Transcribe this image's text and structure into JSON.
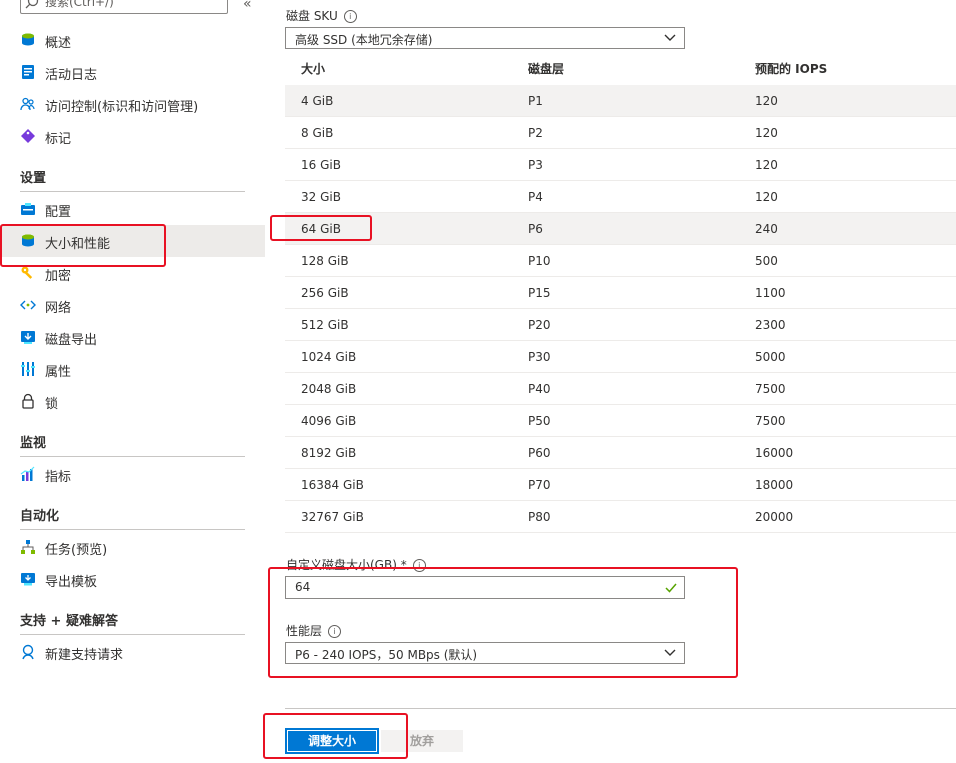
{
  "sidebar": {
    "search_placeholder": "搜索(Ctrl+/)",
    "collapse_glyph": "«",
    "items_top": [
      {
        "label": "概述",
        "icon": "disk-overview-icon"
      },
      {
        "label": "活动日志",
        "icon": "activity-log-icon"
      },
      {
        "label": "访问控制(标识和访问管理)",
        "icon": "access-control-icon"
      },
      {
        "label": "标记",
        "icon": "tag-icon"
      }
    ],
    "sections": [
      {
        "title": "设置",
        "items": [
          {
            "label": "配置",
            "icon": "configuration-icon"
          },
          {
            "label": "大小和性能",
            "icon": "disk-size-icon",
            "active": true
          },
          {
            "label": "加密",
            "icon": "key-icon"
          },
          {
            "label": "网络",
            "icon": "network-icon"
          },
          {
            "label": "磁盘导出",
            "icon": "disk-export-icon"
          },
          {
            "label": "属性",
            "icon": "properties-icon"
          },
          {
            "label": "锁",
            "icon": "lock-icon"
          }
        ]
      },
      {
        "title": "监视",
        "items": [
          {
            "label": "指标",
            "icon": "metrics-icon"
          }
        ]
      },
      {
        "title": "自动化",
        "items": [
          {
            "label": "任务(预览)",
            "icon": "tasks-icon"
          },
          {
            "label": "导出模板",
            "icon": "export-template-icon"
          }
        ]
      },
      {
        "title": "支持 + 疑难解答",
        "items": [
          {
            "label": "新建支持请求",
            "icon": "support-request-icon"
          }
        ]
      }
    ]
  },
  "main": {
    "sku_label": "磁盘 SKU",
    "sku_value": "高级 SSD (本地冗余存储)",
    "table": {
      "headers": [
        "大小",
        "磁盘层",
        "预配的 IOPS"
      ],
      "selected_index": 4,
      "rows": [
        [
          "4 GiB",
          "P1",
          "120"
        ],
        [
          "8 GiB",
          "P2",
          "120"
        ],
        [
          "16 GiB",
          "P3",
          "120"
        ],
        [
          "32 GiB",
          "P4",
          "120"
        ],
        [
          "64 GiB",
          "P6",
          "240"
        ],
        [
          "128 GiB",
          "P10",
          "500"
        ],
        [
          "256 GiB",
          "P15",
          "1100"
        ],
        [
          "512 GiB",
          "P20",
          "2300"
        ],
        [
          "1024 GiB",
          "P30",
          "5000"
        ],
        [
          "2048 GiB",
          "P40",
          "7500"
        ],
        [
          "4096 GiB",
          "P50",
          "7500"
        ],
        [
          "8192 GiB",
          "P60",
          "16000"
        ],
        [
          "16384 GiB",
          "P70",
          "18000"
        ],
        [
          "32767 GiB",
          "P80",
          "20000"
        ]
      ]
    },
    "custom_size_label": "自定义磁盘大小(GB) *",
    "custom_size_value": "64",
    "perf_tier_label": "性能层",
    "perf_tier_value": "P6 - 240 IOPS，50 MBps (默认)",
    "info_glyph": "i",
    "resize_button": "调整大小",
    "discard_button": "放弃"
  },
  "colors": {
    "accent": "#0078d4",
    "highlight": "#e81123",
    "valid": "#57a300"
  }
}
